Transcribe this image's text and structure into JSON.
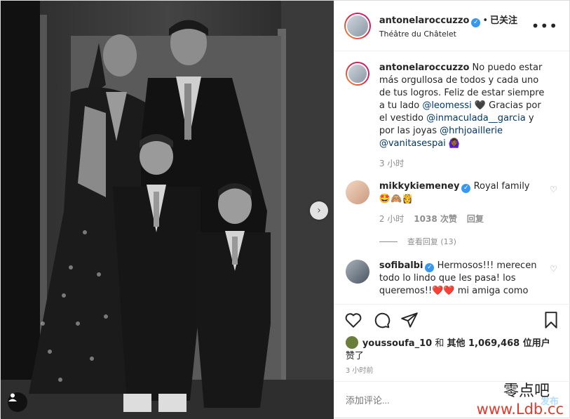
{
  "header": {
    "username": "antonelaroccuzzo",
    "verified_icon": "verified-badge-icon",
    "dot": "•",
    "follow": "已关注",
    "location": "Théâtre du Châtelet",
    "more_icon": "more-options-icon"
  },
  "caption": {
    "username": "antonelaroccuzzo",
    "t1": " No puedo estar más orgullosa de todos y cada uno de tus logros. Feliz de estar siempre a tu lado ",
    "m1": "@leomessi",
    "t2": " 🖤 Gracias por el vestido ",
    "m2": "@inmaculada__garcia",
    "t3": " y por las joyas ",
    "m3": "@hrhjoaillerie",
    "m4": "@vanitasespai",
    "t4": " 🙆🏾‍♀️",
    "time": "3 小时"
  },
  "comments": [
    {
      "username": "mikkykiemeney",
      "text": " Royal family",
      "text2": "🤩🙈👸",
      "time": "2 小时",
      "likes": "1038 次赞",
      "reply": "回复",
      "view_replies": "查看回复 (13)"
    },
    {
      "username": "sofibalbi",
      "text": " Hermosos!!! merecen todo lo lindo que les pasa! los queremos!!❤️❤️ mi amiga como"
    }
  ],
  "likes": {
    "user": "youssoufa_10",
    "and": "和",
    "others": "其他 1,069,468 位用户",
    "liked": "赞了"
  },
  "time_ago": "3 小时前",
  "add_comment": {
    "placeholder": "添加评论...",
    "post": "发布"
  },
  "watermark": {
    "cn": "零点吧",
    "url": "www.Ldb.cc"
  },
  "colors": {
    "verified": "#3897f0",
    "link": "#00376b",
    "muted": "#8e8e8e"
  }
}
